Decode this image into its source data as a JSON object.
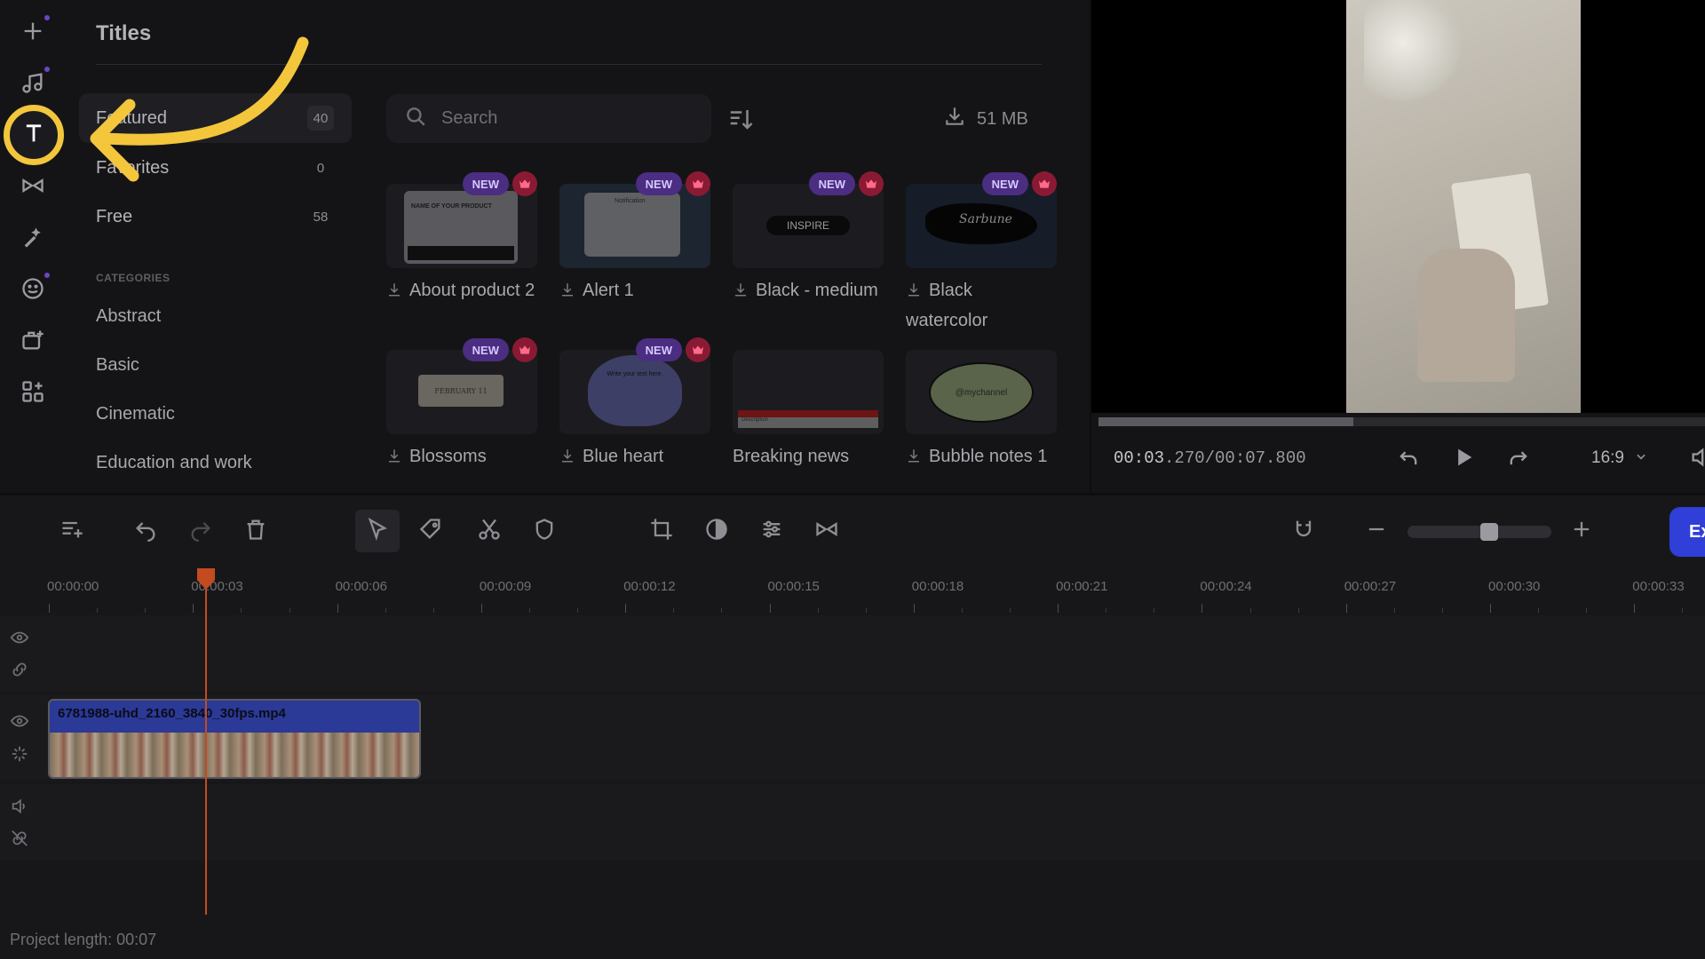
{
  "sidebar": {
    "items": [
      {
        "name": "add-media",
        "icon": "plus-icon"
      },
      {
        "name": "audio",
        "icon": "music-note-icon"
      },
      {
        "name": "titles",
        "icon": "text-t-icon",
        "active": true
      },
      {
        "name": "transitions",
        "icon": "transitions-icon"
      },
      {
        "name": "filters",
        "icon": "magic-wand-icon"
      },
      {
        "name": "stickers",
        "icon": "smiley-icon"
      },
      {
        "name": "elements",
        "icon": "briefcase-plus-icon"
      },
      {
        "name": "templates",
        "icon": "grid-plus-icon"
      }
    ]
  },
  "panel": {
    "title": "Titles",
    "filters": [
      {
        "label": "Featured",
        "count": "40"
      },
      {
        "label": "Favorites",
        "count": "0"
      },
      {
        "label": "Free",
        "count": "58"
      }
    ],
    "categories_heading": "CATEGORIES",
    "categories": [
      "Abstract",
      "Basic",
      "Cinematic",
      "Education and work"
    ]
  },
  "search": {
    "placeholder": "Search"
  },
  "download_size": "51 MB",
  "cards": [
    {
      "label": "About product 2",
      "new": "NEW",
      "premium": true,
      "thumb_text": "NAME OF YOUR PRODUCT"
    },
    {
      "label": "Alert 1",
      "new": "NEW",
      "premium": true,
      "thumb_text": "Notification"
    },
    {
      "label": "Black - medium",
      "new": "NEW",
      "premium": true,
      "thumb_text": "INSPIRE"
    },
    {
      "label": "Black watercolor",
      "new": "NEW",
      "premium": true,
      "thumb_text": "Sarbune"
    },
    {
      "label": "Blossoms",
      "new": "NEW",
      "premium": true,
      "thumb_text": "FEBRUARY 11"
    },
    {
      "label": "Blue heart",
      "new": "NEW",
      "premium": true,
      "thumb_text": "Write your text here."
    },
    {
      "label": "Breaking news",
      "new": "",
      "premium": false,
      "thumb_text": "Description"
    },
    {
      "label": "Bubble notes 1",
      "new": "",
      "premium": false,
      "thumb_text": "@mychannel"
    }
  ],
  "preview": {
    "time_current": "00:03",
    "time_rest": ".270/00:07.800",
    "progress": 0.42,
    "aspect_ratio": "16:9"
  },
  "timeline": {
    "ruler_ticks": [
      "00:00:00",
      "00:00:03",
      "00:00:06",
      "00:00:09",
      "00:00:12",
      "00:00:15",
      "00:00:18",
      "00:00:21",
      "00:00:24",
      "00:00:27",
      "00:00:30",
      "00:00:33"
    ],
    "clip_name": "6781988-uhd_2160_3840_30fps.mp4",
    "zoom_level": 0.58,
    "export_label": "Ex",
    "project_length": "Project length: 00:07"
  },
  "colors": {
    "accent_highlight": "#f3c63c",
    "export_blue": "#2f3fd8",
    "playhead": "#c44a1f",
    "new_badge": "#4b2d82",
    "premium_badge": "#8a1a33"
  }
}
